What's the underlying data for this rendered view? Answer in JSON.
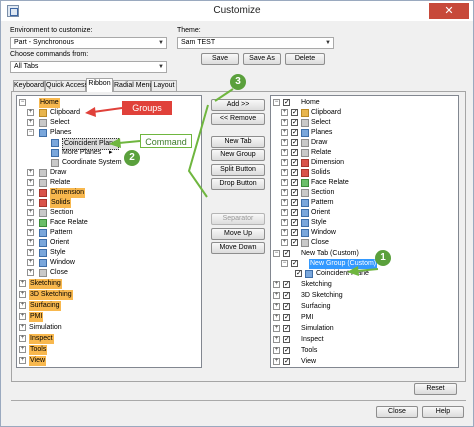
{
  "window": {
    "title": "Customize",
    "close_glyph": "✕"
  },
  "env": {
    "label": "Environment to customize:",
    "value": "Part - Synchronous",
    "commands_label": "Choose commands from:",
    "commands_value": "All Tabs"
  },
  "theme": {
    "label": "Theme:",
    "value": "Sam TEST",
    "save": "Save",
    "save_as": "Save As",
    "delete": "Delete"
  },
  "tabs": [
    "Keyboard",
    "Quick Access",
    "Ribbon",
    "Radial Menu",
    "Layout"
  ],
  "middle_buttons": {
    "add": "Add >>",
    "remove": "<< Remove",
    "new_tab": "New Tab",
    "new_group": "New Group",
    "split_button": "Split Button",
    "drop_button": "Drop Button",
    "separator": "Separator",
    "move_up": "Move Up",
    "move_down": "Move Down"
  },
  "left_tree": {
    "home": "Home",
    "clipboard": "Clipboard",
    "select": "Select",
    "planes": "Planes",
    "coincident_plane": "Coincident Plane",
    "more_planes": "More Planes",
    "more_planes_arrow": "▸",
    "coordinate_system": "Coordinate System",
    "draw": "Draw",
    "relate": "Relate",
    "dimension": "Dimension",
    "solids": "Solids",
    "section": "Section",
    "face_relate": "Face Relate",
    "pattern": "Pattern",
    "orient": "Orient",
    "style": "Style",
    "window": "Window",
    "close": "Close",
    "sketching": "Sketching",
    "sketching_3d": "3D Sketching",
    "surfacing": "Surfacing",
    "pmi": "PMI",
    "simulation": "Simulation",
    "inspect": "Inspect",
    "tools": "Tools",
    "view": "View"
  },
  "right_tree": {
    "home": "Home",
    "clipboard": "Clipboard",
    "select": "Select",
    "planes": "Planes",
    "draw": "Draw",
    "relate": "Relate",
    "dimension": "Dimension",
    "solids": "Solids",
    "face_relate": "Face Relate",
    "section": "Section",
    "pattern": "Pattern",
    "orient": "Orient",
    "style": "Style",
    "window": "Window",
    "close": "Close",
    "new_tab": "New Tab (Custom)",
    "new_group": "New Group (Custom)",
    "coincident_plane": "Coincident Plane",
    "sketching": "Sketching",
    "sketching_3d": "3D Sketching",
    "surfacing": "Surfacing",
    "pmi": "PMI",
    "simulation": "Simulation",
    "inspect": "Inspect",
    "tools": "Tools",
    "view": "View"
  },
  "annotations": {
    "groups": "Groups",
    "command": "Command",
    "badge1": "1",
    "badge2": "2",
    "badge3": "3"
  },
  "bottom": {
    "reset": "Reset",
    "close": "Close",
    "help": "Help"
  },
  "colors": {
    "highlight_orange": "#f8b84e",
    "selection_blue": "#3399ff",
    "groups_callout": "#e0413a",
    "command_callout": "#6fb63f",
    "badge_green": "#5aa03c"
  }
}
